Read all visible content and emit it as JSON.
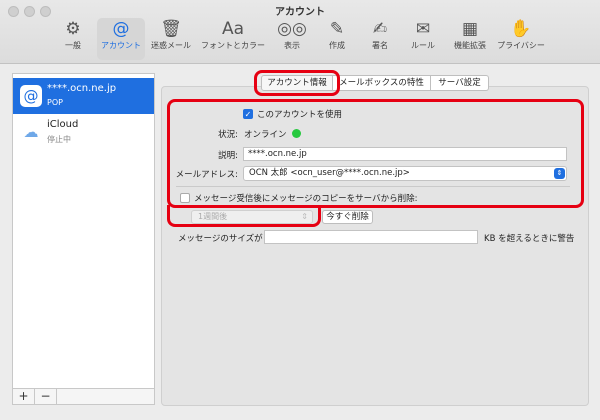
{
  "window": {
    "title": "アカウント"
  },
  "toolbar": {
    "items": [
      {
        "label": "一般",
        "icon": "⚙"
      },
      {
        "label": "アカウント",
        "icon": "@"
      },
      {
        "label": "迷惑メール",
        "icon": "🗑"
      },
      {
        "label": "フォントとカラー",
        "icon": "Aa"
      },
      {
        "label": "表示",
        "icon": "◎◎"
      },
      {
        "label": "作成",
        "icon": "✎"
      },
      {
        "label": "署名",
        "icon": "✍"
      },
      {
        "label": "ルール",
        "icon": "✉"
      },
      {
        "label": "機能拡張",
        "icon": "▦"
      },
      {
        "label": "プライバシー",
        "icon": "✋"
      }
    ]
  },
  "sidebar": {
    "accounts": [
      {
        "name": "****.ocn.ne.jp",
        "sub": "POP",
        "icon": "@"
      },
      {
        "name": "iCloud",
        "sub": "停止中",
        "icon": "☁"
      }
    ],
    "add_label": "+",
    "remove_label": "−"
  },
  "tabs": {
    "account_info": "アカウント情報",
    "mailbox": "メールボックスの特性",
    "server": "サーバ設定"
  },
  "form": {
    "use_account_label": "このアカウントを使用",
    "status_label": "状況:",
    "status_value": "オンライン",
    "desc_label": "説明:",
    "desc_value": "****.ocn.ne.jp",
    "email_label": "メールアドレス:",
    "email_value": "OCN 太郎 <ocn_user@****.ocn.ne.jp>",
    "delete_copy_label": "メッセージ受信後にメッセージのコピーをサーバから削除:",
    "period_value": "1週間後",
    "delete_now_label": "今すぐ削除",
    "size_label_pre": "メッセージのサイズが",
    "size_label_post": "KB を超えるときに警告",
    "size_value": ""
  },
  "colors": {
    "accent": "#1f6fe0",
    "highlight_ring": "#e60012",
    "online": "#27c93f"
  }
}
